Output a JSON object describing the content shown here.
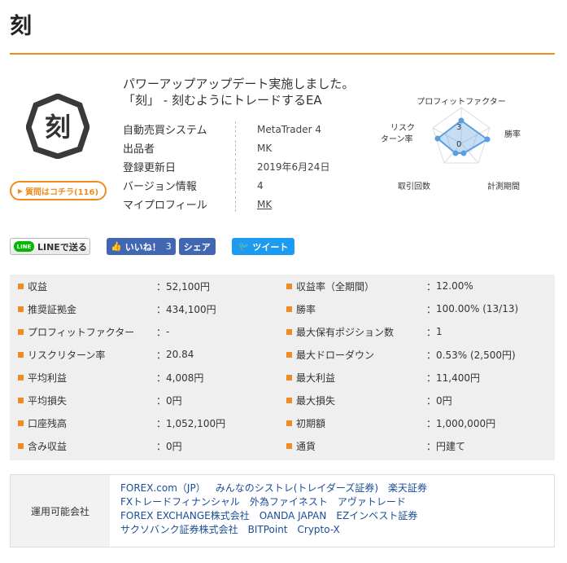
{
  "page": {
    "title": "刻"
  },
  "question_button": {
    "label": "質問はコチラ(116)"
  },
  "ea": {
    "title": "パワーアップアップデート実施しました。「刻」 - 刻むようにトレードするEA",
    "logo_char": "刻"
  },
  "info": [
    {
      "label": "自動売買システム",
      "value": "MetaTrader 4"
    },
    {
      "label": "出品者",
      "value": "MK"
    },
    {
      "label": "登録更新日",
      "value": "2019年6月24日"
    },
    {
      "label": "バージョン情報",
      "value": "4"
    },
    {
      "label": "マイプロフィール",
      "value": "MK"
    }
  ],
  "radar": {
    "labels": {
      "top": "プロフィットファクター",
      "right": "勝率",
      "bottom_right": "計測期間",
      "bottom_left": "取引回数",
      "left": "リスク\nターン率"
    },
    "tick_labels": [
      "3",
      "0"
    ],
    "accent_color": "#5aa0e0"
  },
  "share": {
    "line_label": "LINEで送る",
    "line_icon_text": "LINE",
    "like_label": "いいね！",
    "like_count": "3",
    "share_label": "シェア",
    "tweet_label": "ツイート"
  },
  "stats": {
    "left": [
      {
        "label": "収益",
        "value": "52,100円"
      },
      {
        "label": "推奨証拠金",
        "value": "434,100円"
      },
      {
        "label": "プロフィットファクター",
        "value": "-"
      },
      {
        "label": "リスクリターン率",
        "value": "20.84"
      },
      {
        "label": "平均利益",
        "value": "4,008円"
      },
      {
        "label": "平均損失",
        "value": "0円"
      },
      {
        "label": "口座残高",
        "value": "1,052,100円"
      },
      {
        "label": "含み収益",
        "value": "0円"
      }
    ],
    "right": [
      {
        "label": "収益率（全期間）",
        "value": "12.00%"
      },
      {
        "label": "勝率",
        "value": "100.00% (13/13)"
      },
      {
        "label": "最大保有ポジション数",
        "value": "1"
      },
      {
        "label": "最大ドローダウン",
        "value": "0.53% (2,500円)"
      },
      {
        "label": "最大利益",
        "value": "11,400円"
      },
      {
        "label": "最大損失",
        "value": "0円"
      },
      {
        "label": "初期額",
        "value": "1,000,000円"
      },
      {
        "label": "通貨",
        "value": "円建て"
      }
    ]
  },
  "brokers": {
    "label": "運用可能会社",
    "lines": [
      [
        "FOREX.com（JP）",
        "みんなのシストレ(トレイダーズ証券)",
        "楽天証券"
      ],
      [
        "FXトレードフィナンシャル",
        "外為ファイネスト",
        "アヴァトレード"
      ],
      [
        "FOREX EXCHANGE株式会社",
        "OANDA JAPAN",
        "EZインベスト証券"
      ],
      [
        "サクソバンク証券株式会社",
        "BITPoint",
        "Crypto-X"
      ]
    ]
  }
}
